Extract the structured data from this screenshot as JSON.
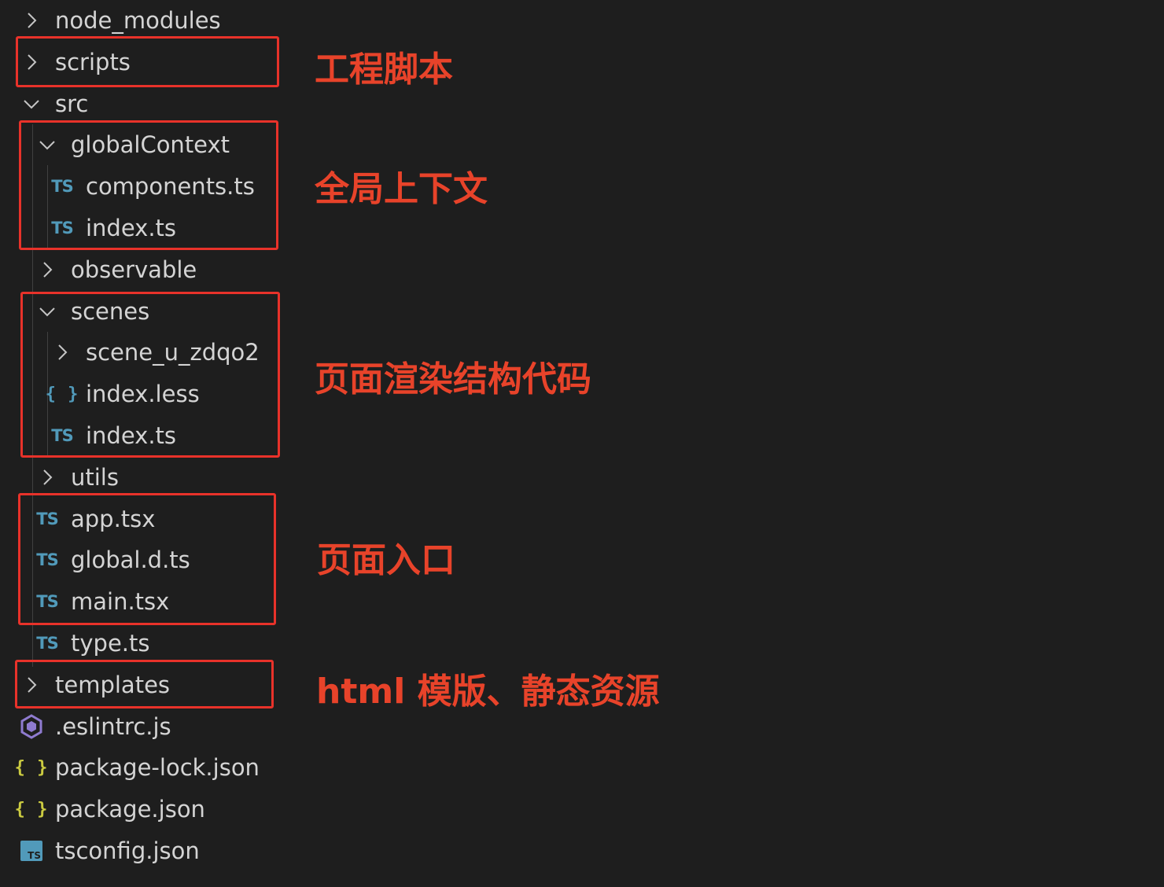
{
  "explorer": {
    "items": [
      {
        "label": "node_modules",
        "kind": "folder",
        "state": "collapsed",
        "icon": "chevron-right-icon"
      },
      {
        "label": "scripts",
        "kind": "folder",
        "state": "collapsed",
        "icon": "chevron-right-icon"
      },
      {
        "label": "src",
        "kind": "folder",
        "state": "expanded",
        "icon": "chevron-down-icon"
      },
      {
        "label": "globalContext",
        "kind": "folder",
        "state": "expanded",
        "icon": "chevron-down-icon"
      },
      {
        "label": "components.ts",
        "kind": "file",
        "icon": "typescript-icon",
        "icon_text": "TS"
      },
      {
        "label": "index.ts",
        "kind": "file",
        "icon": "typescript-icon",
        "icon_text": "TS"
      },
      {
        "label": "observable",
        "kind": "folder",
        "state": "collapsed",
        "icon": "chevron-right-icon"
      },
      {
        "label": "scenes",
        "kind": "folder",
        "state": "expanded",
        "icon": "chevron-down-icon"
      },
      {
        "label": "scene_u_zdqo2",
        "kind": "folder",
        "state": "collapsed",
        "icon": "chevron-right-icon"
      },
      {
        "label": "index.less",
        "kind": "file",
        "icon": "less-braces-icon",
        "icon_text": "{ }"
      },
      {
        "label": "index.ts",
        "kind": "file",
        "icon": "typescript-icon",
        "icon_text": "TS"
      },
      {
        "label": "utils",
        "kind": "folder",
        "state": "collapsed",
        "icon": "chevron-right-icon"
      },
      {
        "label": "app.tsx",
        "kind": "file",
        "icon": "typescript-icon",
        "icon_text": "TS"
      },
      {
        "label": "global.d.ts",
        "kind": "file",
        "icon": "typescript-icon",
        "icon_text": "TS"
      },
      {
        "label": "main.tsx",
        "kind": "file",
        "icon": "typescript-icon",
        "icon_text": "TS"
      },
      {
        "label": "type.ts",
        "kind": "file",
        "icon": "typescript-icon",
        "icon_text": "TS"
      },
      {
        "label": "templates",
        "kind": "folder",
        "state": "collapsed",
        "icon": "chevron-right-icon"
      },
      {
        "label": ".eslintrc.js",
        "kind": "file",
        "icon": "eslint-icon"
      },
      {
        "label": "package-lock.json",
        "kind": "file",
        "icon": "json-braces-icon",
        "icon_text": "{ }"
      },
      {
        "label": "package.json",
        "kind": "file",
        "icon": "json-braces-icon",
        "icon_text": "{ }"
      },
      {
        "label": "tsconfig.json",
        "kind": "file",
        "icon": "tsconfig-icon",
        "icon_text": "TS"
      }
    ]
  },
  "annotations": [
    {
      "text": "工程脚本"
    },
    {
      "text": "全局上下文"
    },
    {
      "text": "页面渲染结构代码"
    },
    {
      "text": "页面入口"
    },
    {
      "text": "html 模版、静态资源"
    }
  ],
  "colors": {
    "background": "#1e1e1e",
    "text": "#d4d4d4",
    "highlight_red": "#e8322a",
    "annotation_red": "#e8432a",
    "ts_blue": "#519aba",
    "json_yellow": "#cbcb41",
    "eslint_purple": "#8f7bd0"
  }
}
